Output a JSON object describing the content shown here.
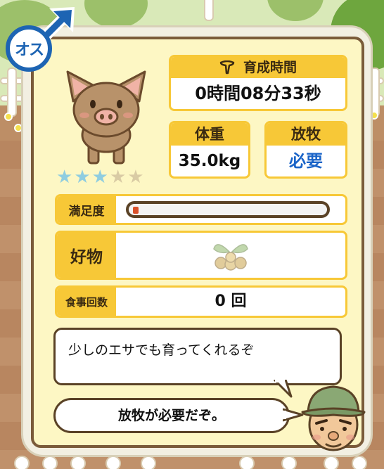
{
  "gender": {
    "label": "オス",
    "color": "#1d64b3"
  },
  "stars": {
    "filled": 3,
    "total": 5
  },
  "rearing_time": {
    "label": "育成時間",
    "value": "0時間08分33秒"
  },
  "weight": {
    "label": "体重",
    "value": "35.0kg"
  },
  "grazing": {
    "label": "放牧",
    "value": "必要"
  },
  "satisfaction": {
    "label": "満足度",
    "level": 0.03
  },
  "favorite": {
    "label": "好物"
  },
  "meals": {
    "label": "食事回数",
    "value": "0 回"
  },
  "messages": {
    "main": "少しのエサでも育ってくれるぞ",
    "notice": "放牧が必要だぞ。"
  },
  "colors": {
    "accent_yellow": "#f7c837",
    "panel": "#fdf7c4",
    "border_brown": "#7a5b3a",
    "value_blue": "#1a64c8",
    "star_filled": "#8fcde0",
    "star_empty": "#d9cba4"
  }
}
